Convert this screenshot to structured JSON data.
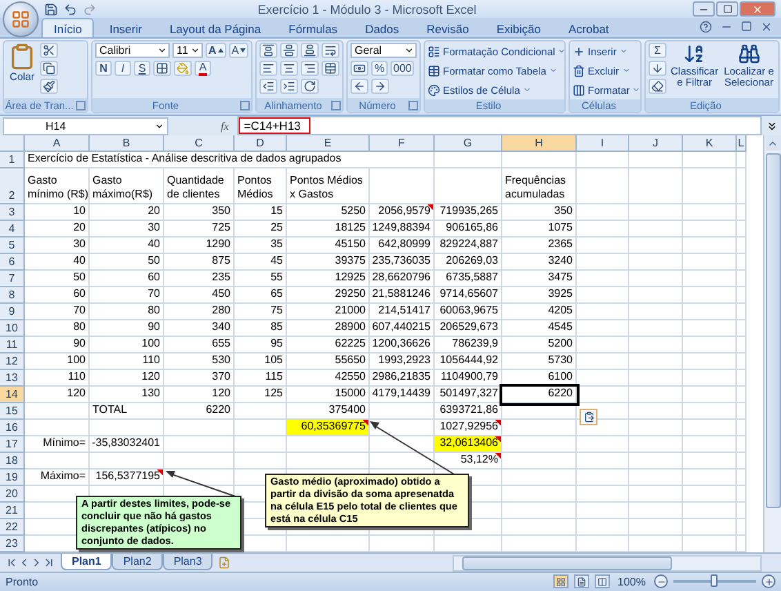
{
  "window": {
    "title": "Exercício 1 - Módulo 3 - Microsoft Excel"
  },
  "ribbon_tabs": [
    {
      "label": "Início",
      "selected": true
    },
    {
      "label": "Inserir",
      "selected": false
    },
    {
      "label": "Layout da Página",
      "selected": false
    },
    {
      "label": "Fórmulas",
      "selected": false
    },
    {
      "label": "Dados",
      "selected": false
    },
    {
      "label": "Revisão",
      "selected": false
    },
    {
      "label": "Exibição",
      "selected": false
    },
    {
      "label": "Acrobat",
      "selected": false
    }
  ],
  "ribbon_groups": [
    {
      "kind": "clipboard",
      "label": "Área de Tran...",
      "paste": "Colar"
    },
    {
      "kind": "font",
      "label": "Fonte",
      "font_name": "Calibri",
      "font_size": "11",
      "grow": "A",
      "shrink": "A",
      "bold": "N",
      "italic": "I",
      "underline": "S",
      "font_color": "A"
    },
    {
      "kind": "alignment",
      "label": "Alinhamento"
    },
    {
      "kind": "number",
      "label": "Número",
      "format": "Geral",
      "percent": "%",
      "thousands": "000"
    },
    {
      "kind": "styles",
      "label": "Estilo",
      "items": [
        "Formatação Condicional",
        "Formatar como Tabela",
        "Estilos de Célula"
      ]
    },
    {
      "kind": "cells",
      "label": "Células",
      "items": [
        "Inserir",
        "Excluir",
        "Formatar"
      ]
    },
    {
      "kind": "editing",
      "label": "Edição",
      "sum": "Σ",
      "sort": "Classificar\ne Filtrar",
      "find": "Localizar e\nSelecionar"
    }
  ],
  "formula_bar": {
    "name_box": "H14",
    "function_label": "fx",
    "formula": "=C14+H13"
  },
  "columns": [
    {
      "label": "A",
      "selected": false
    },
    {
      "label": "B",
      "selected": false
    },
    {
      "label": "C",
      "selected": false
    },
    {
      "label": "D",
      "selected": false
    },
    {
      "label": "E",
      "selected": false
    },
    {
      "label": "F",
      "selected": false
    },
    {
      "label": "G",
      "selected": false
    },
    {
      "label": "H",
      "selected": true
    },
    {
      "label": "I",
      "selected": false
    },
    {
      "label": "J",
      "selected": false
    },
    {
      "label": "K",
      "selected": false
    },
    {
      "label": "L",
      "selected": false
    }
  ],
  "rows": [
    {
      "number": "1",
      "selected": false,
      "cells": [
        "Exercício de Estatística - Análise descritiva de dados agrupados",
        null,
        null,
        null,
        null,
        null,
        null,
        null
      ]
    },
    {
      "number": "2",
      "selected": false,
      "cells": [
        "Gasto\nmínimo (R$)",
        "Gasto\nmáximo(R$)",
        "Quantidade\nde clientes",
        "Pontos\nMédios",
        "Pontos Médios\nx Gastos",
        null,
        null,
        "Frequências\nacumuladas"
      ]
    },
    {
      "number": "3",
      "selected": false,
      "cells": [
        "10",
        "20",
        "350",
        "15",
        "5250",
        {
          "text": "2056,9579",
          "comment": true
        },
        "719935,265",
        "350"
      ]
    },
    {
      "number": "4",
      "selected": false,
      "cells": [
        "20",
        "30",
        "725",
        "25",
        "18125",
        "1249,88394",
        "906165,86",
        "1075"
      ]
    },
    {
      "number": "5",
      "selected": false,
      "cells": [
        "30",
        "40",
        "1290",
        "35",
        "45150",
        "642,80999",
        "829224,887",
        "2365"
      ]
    },
    {
      "number": "6",
      "selected": false,
      "cells": [
        "40",
        "50",
        "875",
        "45",
        "39375",
        "235,736035",
        "206269,03",
        "3240"
      ]
    },
    {
      "number": "7",
      "selected": false,
      "cells": [
        "50",
        "60",
        "235",
        "55",
        "12925",
        "28,6620796",
        "6735,5887",
        "3475"
      ]
    },
    {
      "number": "8",
      "selected": false,
      "cells": [
        "60",
        "70",
        "450",
        "65",
        "29250",
        "21,5881246",
        "9714,65607",
        "3925"
      ]
    },
    {
      "number": "9",
      "selected": false,
      "cells": [
        "70",
        "80",
        "280",
        "75",
        "21000",
        "214,51417",
        "60063,9675",
        "4205"
      ]
    },
    {
      "number": "10",
      "selected": false,
      "cells": [
        "80",
        "90",
        "340",
        "85",
        "28900",
        "607,440215",
        "206529,673",
        "4545"
      ]
    },
    {
      "number": "11",
      "selected": false,
      "cells": [
        "90",
        "100",
        "655",
        "95",
        "62225",
        "1200,36626",
        "786239,9",
        "5200"
      ]
    },
    {
      "number": "12",
      "selected": false,
      "cells": [
        "100",
        "110",
        "530",
        "105",
        "55650",
        "1993,2923",
        "1056444,92",
        "5730"
      ]
    },
    {
      "number": "13",
      "selected": false,
      "cells": [
        "110",
        "120",
        "370",
        "115",
        "42550",
        "2986,21835",
        "1104900,79",
        "6100"
      ]
    },
    {
      "number": "14",
      "selected": true,
      "cells": [
        "120",
        "130",
        "120",
        "125",
        "15000",
        "4179,14439",
        "501497,327",
        {
          "text": "6220",
          "selected": true
        }
      ]
    },
    {
      "number": "15",
      "selected": false,
      "cells": [
        null,
        {
          "text": "TOTAL",
          "kind": "text"
        },
        "6220",
        null,
        "375400",
        null,
        "6393721,86",
        null
      ]
    },
    {
      "number": "16",
      "selected": false,
      "cells": [
        null,
        null,
        null,
        null,
        {
          "text": "60,35369775",
          "highlighted": true,
          "comment": true
        },
        null,
        {
          "text": "1027,92956",
          "comment": true
        },
        null
      ]
    },
    {
      "number": "17",
      "selected": false,
      "cells": [
        {
          "text": "Mínimo=",
          "kind": "label"
        },
        "-35,83032401",
        null,
        null,
        null,
        null,
        {
          "text": "32,0613406",
          "highlighted": true,
          "comment": true
        },
        null
      ]
    },
    {
      "number": "18",
      "selected": false,
      "cells": [
        null,
        null,
        null,
        null,
        null,
        null,
        {
          "text": "53,12%",
          "comment": true
        },
        null
      ]
    },
    {
      "number": "19",
      "selected": false,
      "cells": [
        {
          "text": "Máximo=",
          "kind": "label"
        },
        {
          "text": "156,5377195",
          "comment": true
        },
        null,
        null,
        null,
        null,
        null,
        null
      ]
    },
    {
      "number": "20",
      "selected": false,
      "cells": [
        null,
        null,
        null,
        null,
        null,
        null,
        null,
        null
      ]
    },
    {
      "number": "21",
      "selected": false,
      "cells": [
        null,
        null,
        null,
        null,
        null,
        null,
        null,
        null
      ]
    },
    {
      "number": "22",
      "selected": false,
      "cells": [
        null,
        null,
        null,
        null,
        null,
        null,
        null,
        null
      ]
    },
    {
      "number": "23",
      "selected": false,
      "cells": [
        null,
        null,
        null,
        null,
        null,
        null,
        null,
        null
      ]
    }
  ],
  "comments": [
    {
      "text": "A partir destes limites, pode-se concluir que não há gastos discrepantes (atípicos) no conjunto de dados.",
      "color": "#ccffcc"
    },
    {
      "text": "Gasto médio (aproximado) obtido a partir da divisão da soma apresenatda na célula E15 pelo total de clientes que está na célula C15",
      "color": "#ffffcc"
    }
  ],
  "sheet_tabs": [
    {
      "label": "Plan1",
      "selected": true
    },
    {
      "label": "Plan2",
      "selected": false
    },
    {
      "label": "Plan3",
      "selected": false
    }
  ],
  "status_bar": {
    "status": "Pronto",
    "zoom": {
      "reading": "100%",
      "level": 0.5
    }
  }
}
